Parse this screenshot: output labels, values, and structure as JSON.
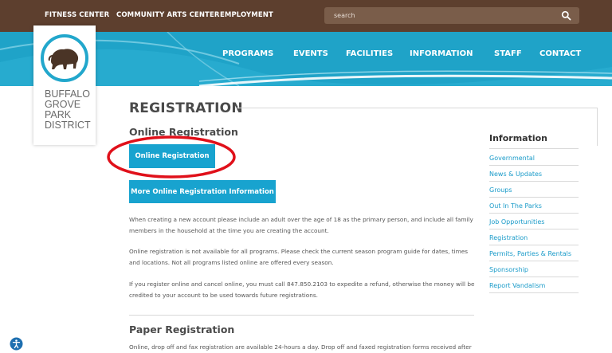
{
  "topbar": {
    "links": [
      "FITNESS CENTER",
      "COMMUNITY ARTS CENTER",
      "EMPLOYMENT"
    ],
    "search_placeholder": "search",
    "search_icon": "search-icon"
  },
  "nav": {
    "items": [
      "PROGRAMS",
      "EVENTS",
      "FACILITIES",
      "INFORMATION",
      "STAFF",
      "CONTACT"
    ]
  },
  "logo": {
    "icon": "bison-icon",
    "lines": [
      "BUFFALO",
      "GROVE",
      "PARK",
      "DISTRICT"
    ]
  },
  "main": {
    "title": "REGISTRATION",
    "online_heading": "Online Registration",
    "online_button": "Online Registration",
    "more_button": "More Online Registration Information",
    "paragraphs": [
      "When creating a new account please include an adult over the age of 18 as the primary person, and include all family members in the household at the time you are creating the account.",
      "Online registration is not available for all programs.  Please check the current season program guide for dates, times and locations.  Not all programs listed online are offered every season.",
      "If you register online and cancel online, you must call 847.850.2103 to expedite a refund, otherwise the money will be credited to your account to be used towards future registrations."
    ],
    "paper_heading": "Paper Registration",
    "paper_text": "Online, drop off and fax registration are available 24-hours a day.  Drop off and faxed registration forms received after"
  },
  "sidebar": {
    "title": "Information",
    "links": [
      "Governmental",
      "News & Updates",
      "Groups",
      "Out In The Parks",
      "Job Opportunities",
      "Registration",
      "Permits, Parties & Rentals",
      "Sponsorship",
      "Report Vandalism"
    ]
  },
  "colors": {
    "topbar": "#5d3f2e",
    "nav": "#1fa3c8",
    "button": "#18a3cf",
    "link": "#1a9bc9",
    "highlight_ring": "#e0101a"
  },
  "accessibility": {
    "icon": "accessibility-icon"
  }
}
